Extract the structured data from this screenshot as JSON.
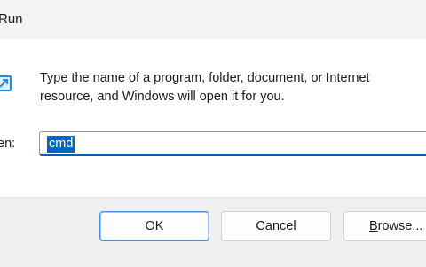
{
  "window": {
    "title": "Run",
    "icon": "run-icon"
  },
  "content": {
    "description": "Type the name of a program, folder, document, or Internet resource, and Windows will open it for you.",
    "description_line1": "Type the name of a program, folder, document, or Internet",
    "description_line2": "resource, and Windows will open it for you.",
    "open_label": "en:",
    "open_value": "cmd"
  },
  "buttons": {
    "ok": "OK",
    "cancel": "Cancel",
    "browse_mnemonic": "B",
    "browse_rest": "rowse..."
  },
  "colors": {
    "accent": "#005fb8",
    "selection": "#0067c0",
    "background": "#f3f3f3"
  }
}
